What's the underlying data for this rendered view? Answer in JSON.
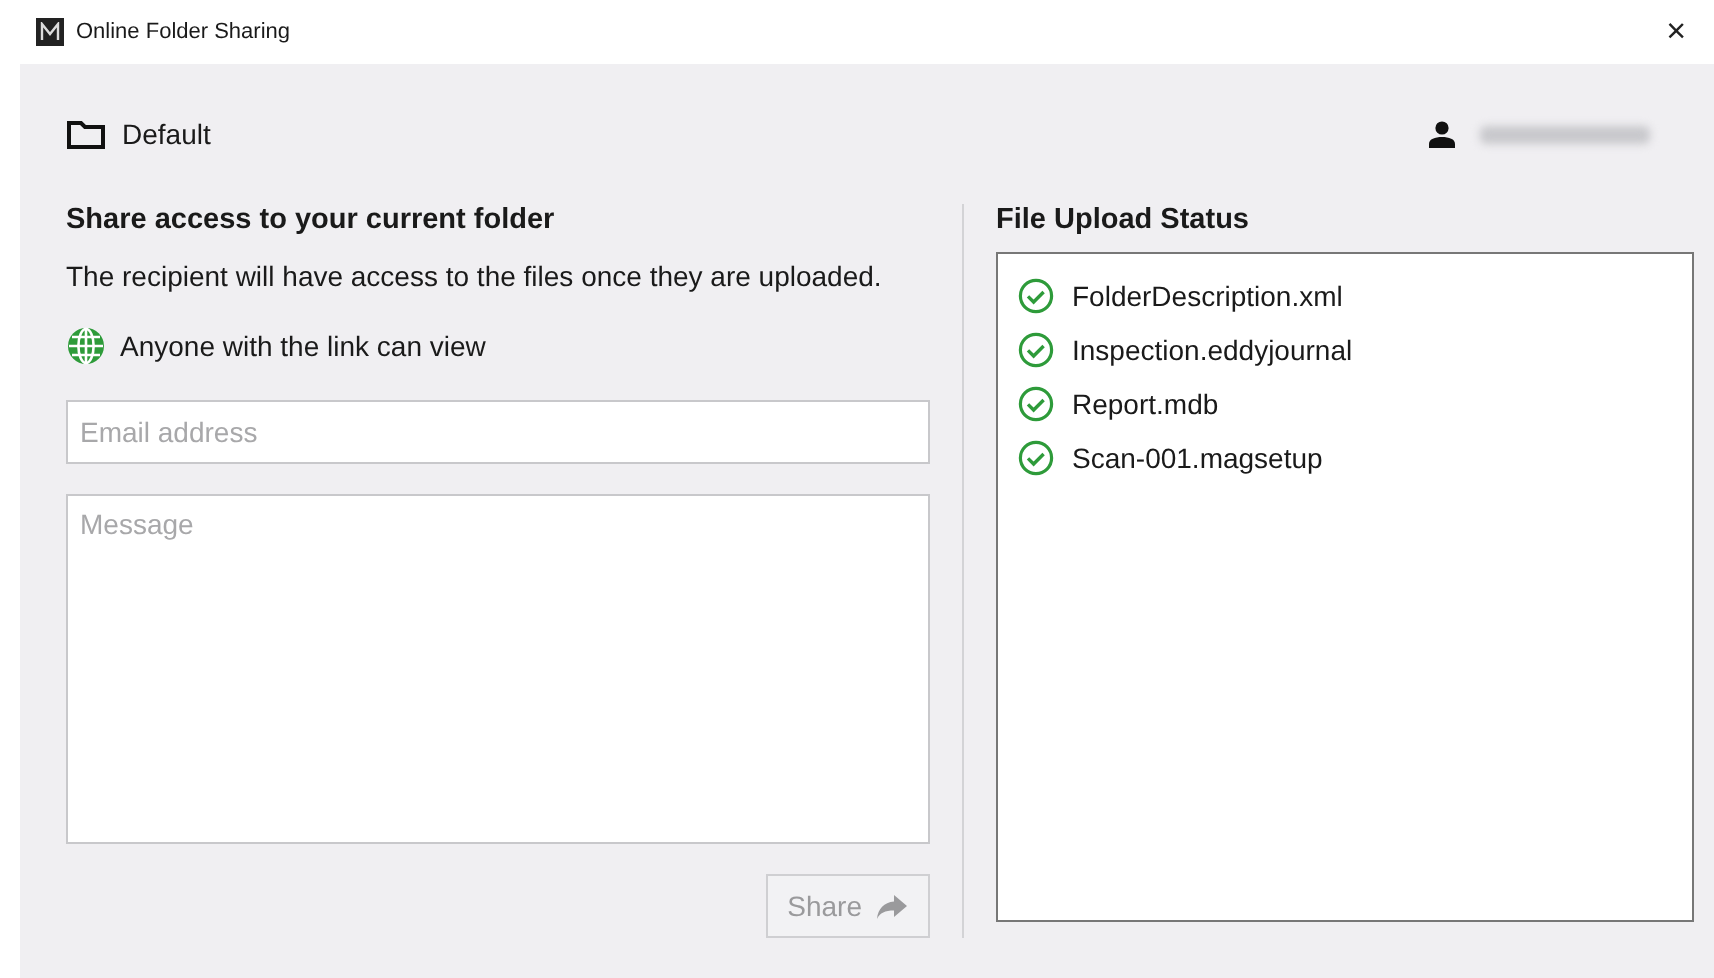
{
  "window": {
    "title": "Online Folder Sharing",
    "close": "×"
  },
  "folder": {
    "name": "Default"
  },
  "share": {
    "heading": "Share access to your current folder",
    "description": "The recipient will have access to the files once they are uploaded.",
    "access": "Anyone with the link can view",
    "email": {
      "placeholder": "Email address"
    },
    "message": {
      "placeholder": "Message"
    },
    "button": {
      "label": "Share",
      "disabled": true
    }
  },
  "upload_status": {
    "heading": "File Upload Status",
    "files": [
      {
        "name": "FolderDescription.xml",
        "uploaded": true
      },
      {
        "name": "Inspection.eddyjournal",
        "uploaded": true
      },
      {
        "name": "Report.mdb",
        "uploaded": true
      },
      {
        "name": "Scan-001.magsetup",
        "uploaded": true
      }
    ]
  }
}
